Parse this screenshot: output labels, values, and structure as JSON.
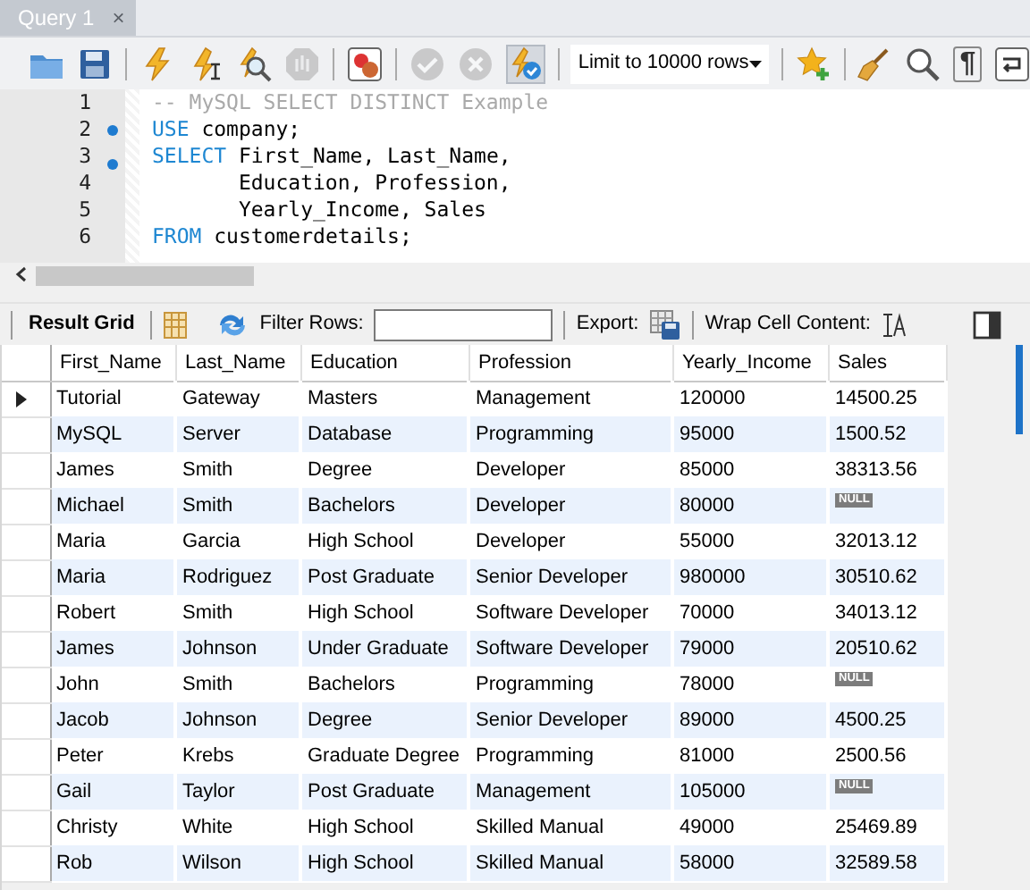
{
  "tab": {
    "title": "Query 1",
    "close": "×",
    "selected": true
  },
  "toolbar": [
    {
      "kind": "folder",
      "disabled": false,
      "pressed": false
    },
    {
      "kind": "save",
      "disabled": false,
      "pressed": false
    },
    {
      "kind": "sep"
    },
    {
      "kind": "bolt",
      "disabled": false,
      "pressed": false
    },
    {
      "kind": "bolt-cursor",
      "disabled": false,
      "pressed": false
    },
    {
      "kind": "bolt-magnifier",
      "disabled": false,
      "pressed": false
    },
    {
      "kind": "stop",
      "disabled": true,
      "pressed": false
    },
    {
      "kind": "sep"
    },
    {
      "kind": "error-toggle",
      "disabled": false,
      "pressed": false
    },
    {
      "kind": "sep"
    },
    {
      "kind": "commit",
      "disabled": true,
      "pressed": false
    },
    {
      "kind": "rollback",
      "disabled": true,
      "pressed": false
    },
    {
      "kind": "autocommit",
      "disabled": false,
      "pressed": true
    },
    {
      "kind": "sep"
    },
    {
      "kind": "limit",
      "value": "Limit to 10000 rows"
    },
    {
      "kind": "sep"
    },
    {
      "kind": "star",
      "disabled": false,
      "pressed": false
    },
    {
      "kind": "sep"
    },
    {
      "kind": "broom",
      "disabled": false,
      "pressed": false
    },
    {
      "kind": "magnifier",
      "disabled": false,
      "pressed": false
    },
    {
      "kind": "pilcrow",
      "text": "¶",
      "disabled": false,
      "pressed": false
    },
    {
      "kind": "wrap",
      "disabled": false,
      "pressed": false
    }
  ],
  "editor": {
    "lines": [
      {
        "number": "1",
        "marker": false,
        "indented": false,
        "tokens": [
          {
            "kind": "comment",
            "text": "-- MySQL SELECT DISTINCT Example"
          }
        ]
      },
      {
        "number": "2",
        "marker": true,
        "indented": false,
        "tokens": [
          {
            "kind": "keyword",
            "text": "USE"
          },
          {
            "kind": "plain",
            "text": " company;"
          }
        ]
      },
      {
        "number": "3",
        "marker": true,
        "indented": false,
        "tokens": [
          {
            "kind": "keyword",
            "text": "SELECT"
          },
          {
            "kind": "plain",
            "text": " First_Name, Last_Name,"
          }
        ]
      },
      {
        "number": "4",
        "marker": false,
        "indented": true,
        "tokens": [
          {
            "kind": "plain",
            "text": "Education, Profession,"
          }
        ]
      },
      {
        "number": "5",
        "marker": false,
        "indented": true,
        "tokens": [
          {
            "kind": "plain",
            "text": "Yearly_Income, Sales"
          }
        ]
      },
      {
        "number": "6",
        "marker": false,
        "indented": false,
        "tokens": [
          {
            "kind": "keyword",
            "text": "FROM"
          },
          {
            "kind": "plain",
            "text": " customerdetails;"
          }
        ]
      }
    ]
  },
  "result_toolbar": {
    "tab": {
      "label": "Result Grid",
      "selected": true
    },
    "filter_label": "Filter Rows:",
    "export_label": "Export:",
    "wrap_label": "Wrap Cell Content:"
  },
  "table": {
    "columns": [
      "First_Name",
      "Last_Name",
      "Education",
      "Profession",
      "Yearly_Income",
      "Sales"
    ],
    "rows": [
      {
        "current": true,
        "cells": [
          "Tutorial",
          "Gateway",
          "Masters",
          "Management",
          "120000"
        ],
        "sales": "14500.25",
        "sales_null": false
      },
      {
        "current": false,
        "cells": [
          "MySQL",
          "Server",
          "Database",
          "Programming",
          "95000"
        ],
        "sales": "1500.52",
        "sales_null": false
      },
      {
        "current": false,
        "cells": [
          "James",
          "Smith",
          "Degree",
          "Developer",
          "85000"
        ],
        "sales": "38313.56",
        "sales_null": false
      },
      {
        "current": false,
        "cells": [
          "Michael",
          "Smith",
          "Bachelors",
          "Developer",
          "80000"
        ],
        "sales": "NULL",
        "sales_null": true
      },
      {
        "current": false,
        "cells": [
          "Maria",
          "Garcia",
          "High School",
          "Developer",
          "55000"
        ],
        "sales": "32013.12",
        "sales_null": false
      },
      {
        "current": false,
        "cells": [
          "Maria",
          "Rodriguez",
          "Post Graduate",
          "Senior Developer",
          "980000"
        ],
        "sales": "30510.62",
        "sales_null": false
      },
      {
        "current": false,
        "cells": [
          "Robert",
          "Smith",
          "High School",
          "Software Developer",
          "70000"
        ],
        "sales": "34013.12",
        "sales_null": false
      },
      {
        "current": false,
        "cells": [
          "James",
          "Johnson",
          "Under Graduate",
          "Software Developer",
          "79000"
        ],
        "sales": "20510.62",
        "sales_null": false
      },
      {
        "current": false,
        "cells": [
          "John",
          "Smith",
          "Bachelors",
          "Programming",
          "78000"
        ],
        "sales": "NULL",
        "sales_null": true
      },
      {
        "current": false,
        "cells": [
          "Jacob",
          "Johnson",
          "Degree",
          "Senior Developer",
          "89000"
        ],
        "sales": "4500.25",
        "sales_null": false
      },
      {
        "current": false,
        "cells": [
          "Peter",
          "Krebs",
          "Graduate Degree",
          "Programming",
          "81000"
        ],
        "sales": "2500.56",
        "sales_null": false
      },
      {
        "current": false,
        "cells": [
          "Gail",
          "Taylor",
          "Post Graduate",
          "Management",
          "105000"
        ],
        "sales": "NULL",
        "sales_null": true
      },
      {
        "current": false,
        "cells": [
          "Christy",
          "White",
          "High School",
          "Skilled Manual",
          "49000"
        ],
        "sales": "25469.89",
        "sales_null": false
      },
      {
        "current": false,
        "cells": [
          "Rob",
          "Wilson",
          "High School",
          "Skilled Manual",
          "58000"
        ],
        "sales": "32589.58",
        "sales_null": false
      }
    ]
  }
}
